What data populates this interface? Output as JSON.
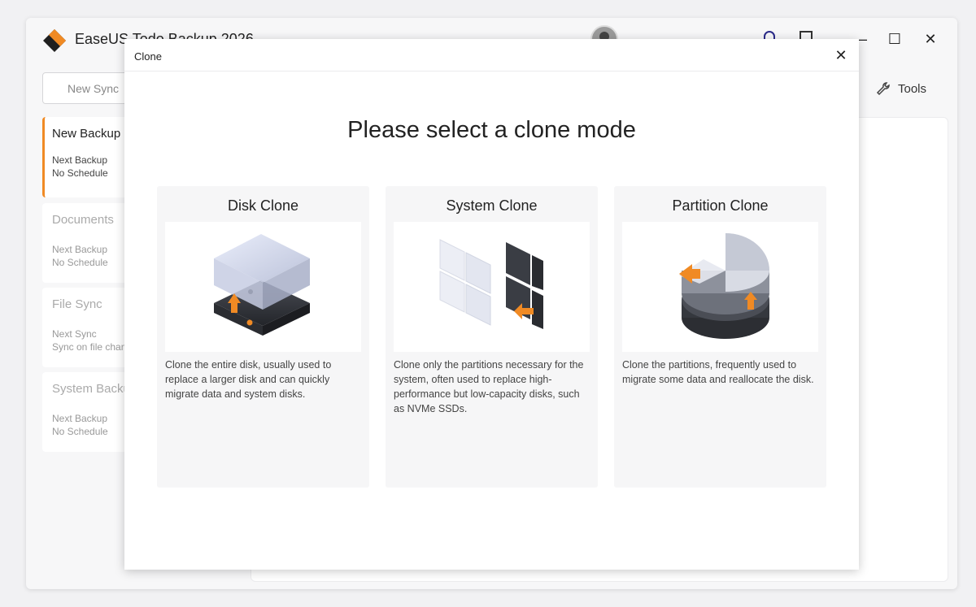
{
  "app": {
    "title": "EaseUS Todo Backup 2026",
    "new_sync_label": "New Sync",
    "tools_label": "Tools"
  },
  "window_controls": {
    "minimize": "—",
    "maximize": "☐",
    "close": "✕"
  },
  "tasks": [
    {
      "name": "New Backup",
      "line1": "Next Backup",
      "line2": "No Schedule"
    },
    {
      "name": "Documents",
      "line1": "Next Backup",
      "line2": "No Schedule"
    },
    {
      "name": "File Sync",
      "line1": "Next Sync",
      "line2": "Sync on file changes"
    },
    {
      "name": "System Backup",
      "line1": "Next Backup",
      "line2": "No Schedule"
    }
  ],
  "modal": {
    "title": "Clone",
    "close": "✕",
    "heading": "Please select a clone mode",
    "options": [
      {
        "title": "Disk Clone",
        "desc": "Clone the entire disk, usually used to replace a larger disk and can quickly migrate data and system disks."
      },
      {
        "title": "System Clone",
        "desc": "Clone only the partitions necessary for the system, often used to replace high-performance but low-capacity disks, such as NVMe SSDs."
      },
      {
        "title": "Partition Clone",
        "desc": "Clone the partitions, frequently used to migrate some data and reallocate the disk."
      }
    ]
  },
  "colors": {
    "accent": "#f08a24",
    "dark": "#2f3237"
  },
  "icons": {
    "logo": "easeus-logo-icon",
    "support": "headset-icon",
    "feedback": "feedback-icon",
    "tools": "wrench-icon"
  }
}
